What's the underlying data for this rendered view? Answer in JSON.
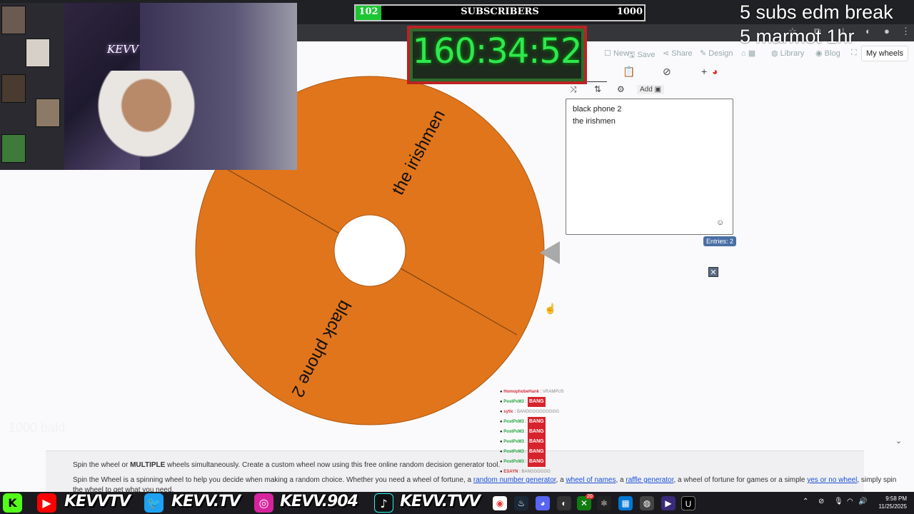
{
  "site": {
    "toolbar": {
      "new": "New",
      "save": "Save",
      "share": "Share",
      "design": "Design",
      "library": "Library",
      "blog": "Blog",
      "my_wheels": "My wheels"
    },
    "wheel": {
      "slices": [
        "the irishmen",
        "black phone 2"
      ],
      "slice_color": "#e0751c"
    },
    "panel": {
      "add_label": "Add",
      "entries_lines": [
        "black phone 2",
        "the irishmen"
      ],
      "entries_count": "Entries: 2"
    },
    "footer": {
      "line1_pre": "Spin the wheel or ",
      "line1_bold": "MULTIPLE",
      "line1_post": " wheels simultaneously. Create a custom wheel now using this free online random decision generator tool.",
      "line2_pre": "Spin the Wheel is a spinning wheel to help you decide when making a random choice. Whether you need a wheel of fortune, a ",
      "link_rng": "random number generator",
      "sep1": ", a ",
      "link_names": "wheel of names",
      "sep2": ", a ",
      "link_raffle": "raffle generator",
      "line2_mid": ", a wheel of fortune for games or a simple ",
      "link_yesno": "yes or no wheel",
      "line2_post": ", simply spin",
      "line3": "the wheel to get what you need."
    }
  },
  "overlay": {
    "subscribers": {
      "current": "102",
      "title": "SUBSCRIBERS",
      "goal": "1000",
      "progress": 0.102
    },
    "timer": "160:34:52",
    "goals": [
      "5 subs edm break",
      "5 marmot 1hr"
    ],
    "webcam_neon": "KEVV",
    "left_list": [
      "",
      "",
      "",
      "",
      "",
      "",
      "",
      "",
      "",
      "",
      "",
      "",
      "1000 bald"
    ],
    "chat": [
      {
        "user": "HomophobeHank",
        "msg": "VRAMPUS",
        "color": "red"
      },
      {
        "user": "PostPxM3",
        "msg": "BANG",
        "color": "green",
        "badge": true
      },
      {
        "user": "sytic",
        "msg": "BANGGGGGGGGGG",
        "color": "red"
      },
      {
        "user": "PostPxM3",
        "msg": "BANG",
        "color": "green",
        "badge": true
      },
      {
        "user": "PostPxM3",
        "msg": "BANG",
        "color": "green",
        "badge": true
      },
      {
        "user": "PostPxM3",
        "msg": "BANG",
        "color": "green",
        "badge": true
      },
      {
        "user": "PostPxM3",
        "msg": "BANG",
        "color": "green",
        "badge": true
      },
      {
        "user": "PostPxM3",
        "msg": "BANG",
        "color": "green",
        "badge": true
      },
      {
        "user": "ESAYN",
        "msg": "BANGGGGGG",
        "color": "red"
      }
    ],
    "social": {
      "kick": "KEVVTV",
      "twitter": "KEVV.TV",
      "instagram": "KEVV.904",
      "tiktok": "KEVV.TVV"
    }
  },
  "taskbar": {
    "time": "9:58 PM",
    "date": "11/25/2025",
    "notification_count": "20"
  },
  "colors": {
    "wheel_orange": "#e0751c",
    "pointer_gray": "#a9a9a9",
    "timer_green": "#2ee84f",
    "sub_fill": "#1cc633"
  }
}
